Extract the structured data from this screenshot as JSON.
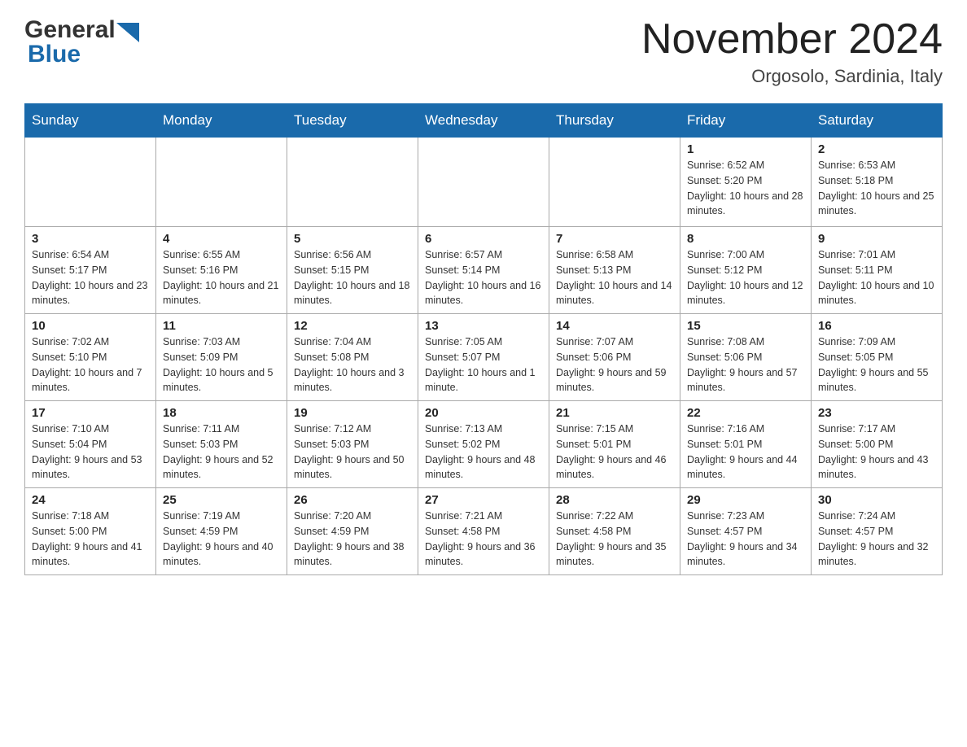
{
  "header": {
    "logo_general": "General",
    "logo_blue": "Blue",
    "month_title": "November 2024",
    "location": "Orgosolo, Sardinia, Italy"
  },
  "calendar": {
    "days_of_week": [
      "Sunday",
      "Monday",
      "Tuesday",
      "Wednesday",
      "Thursday",
      "Friday",
      "Saturday"
    ],
    "weeks": [
      [
        {
          "day": "",
          "info": ""
        },
        {
          "day": "",
          "info": ""
        },
        {
          "day": "",
          "info": ""
        },
        {
          "day": "",
          "info": ""
        },
        {
          "day": "",
          "info": ""
        },
        {
          "day": "1",
          "info": "Sunrise: 6:52 AM\nSunset: 5:20 PM\nDaylight: 10 hours and 28 minutes."
        },
        {
          "day": "2",
          "info": "Sunrise: 6:53 AM\nSunset: 5:18 PM\nDaylight: 10 hours and 25 minutes."
        }
      ],
      [
        {
          "day": "3",
          "info": "Sunrise: 6:54 AM\nSunset: 5:17 PM\nDaylight: 10 hours and 23 minutes."
        },
        {
          "day": "4",
          "info": "Sunrise: 6:55 AM\nSunset: 5:16 PM\nDaylight: 10 hours and 21 minutes."
        },
        {
          "day": "5",
          "info": "Sunrise: 6:56 AM\nSunset: 5:15 PM\nDaylight: 10 hours and 18 minutes."
        },
        {
          "day": "6",
          "info": "Sunrise: 6:57 AM\nSunset: 5:14 PM\nDaylight: 10 hours and 16 minutes."
        },
        {
          "day": "7",
          "info": "Sunrise: 6:58 AM\nSunset: 5:13 PM\nDaylight: 10 hours and 14 minutes."
        },
        {
          "day": "8",
          "info": "Sunrise: 7:00 AM\nSunset: 5:12 PM\nDaylight: 10 hours and 12 minutes."
        },
        {
          "day": "9",
          "info": "Sunrise: 7:01 AM\nSunset: 5:11 PM\nDaylight: 10 hours and 10 minutes."
        }
      ],
      [
        {
          "day": "10",
          "info": "Sunrise: 7:02 AM\nSunset: 5:10 PM\nDaylight: 10 hours and 7 minutes."
        },
        {
          "day": "11",
          "info": "Sunrise: 7:03 AM\nSunset: 5:09 PM\nDaylight: 10 hours and 5 minutes."
        },
        {
          "day": "12",
          "info": "Sunrise: 7:04 AM\nSunset: 5:08 PM\nDaylight: 10 hours and 3 minutes."
        },
        {
          "day": "13",
          "info": "Sunrise: 7:05 AM\nSunset: 5:07 PM\nDaylight: 10 hours and 1 minute."
        },
        {
          "day": "14",
          "info": "Sunrise: 7:07 AM\nSunset: 5:06 PM\nDaylight: 9 hours and 59 minutes."
        },
        {
          "day": "15",
          "info": "Sunrise: 7:08 AM\nSunset: 5:06 PM\nDaylight: 9 hours and 57 minutes."
        },
        {
          "day": "16",
          "info": "Sunrise: 7:09 AM\nSunset: 5:05 PM\nDaylight: 9 hours and 55 minutes."
        }
      ],
      [
        {
          "day": "17",
          "info": "Sunrise: 7:10 AM\nSunset: 5:04 PM\nDaylight: 9 hours and 53 minutes."
        },
        {
          "day": "18",
          "info": "Sunrise: 7:11 AM\nSunset: 5:03 PM\nDaylight: 9 hours and 52 minutes."
        },
        {
          "day": "19",
          "info": "Sunrise: 7:12 AM\nSunset: 5:03 PM\nDaylight: 9 hours and 50 minutes."
        },
        {
          "day": "20",
          "info": "Sunrise: 7:13 AM\nSunset: 5:02 PM\nDaylight: 9 hours and 48 minutes."
        },
        {
          "day": "21",
          "info": "Sunrise: 7:15 AM\nSunset: 5:01 PM\nDaylight: 9 hours and 46 minutes."
        },
        {
          "day": "22",
          "info": "Sunrise: 7:16 AM\nSunset: 5:01 PM\nDaylight: 9 hours and 44 minutes."
        },
        {
          "day": "23",
          "info": "Sunrise: 7:17 AM\nSunset: 5:00 PM\nDaylight: 9 hours and 43 minutes."
        }
      ],
      [
        {
          "day": "24",
          "info": "Sunrise: 7:18 AM\nSunset: 5:00 PM\nDaylight: 9 hours and 41 minutes."
        },
        {
          "day": "25",
          "info": "Sunrise: 7:19 AM\nSunset: 4:59 PM\nDaylight: 9 hours and 40 minutes."
        },
        {
          "day": "26",
          "info": "Sunrise: 7:20 AM\nSunset: 4:59 PM\nDaylight: 9 hours and 38 minutes."
        },
        {
          "day": "27",
          "info": "Sunrise: 7:21 AM\nSunset: 4:58 PM\nDaylight: 9 hours and 36 minutes."
        },
        {
          "day": "28",
          "info": "Sunrise: 7:22 AM\nSunset: 4:58 PM\nDaylight: 9 hours and 35 minutes."
        },
        {
          "day": "29",
          "info": "Sunrise: 7:23 AM\nSunset: 4:57 PM\nDaylight: 9 hours and 34 minutes."
        },
        {
          "day": "30",
          "info": "Sunrise: 7:24 AM\nSunset: 4:57 PM\nDaylight: 9 hours and 32 minutes."
        }
      ]
    ]
  }
}
